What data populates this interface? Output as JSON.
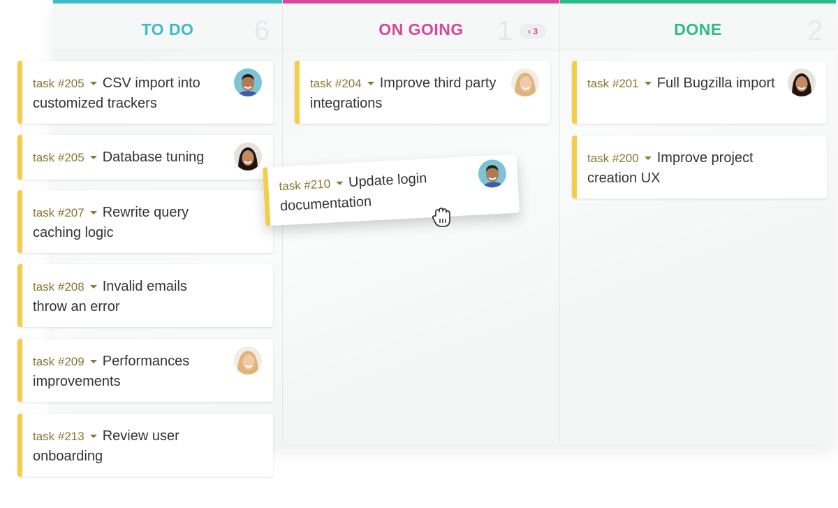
{
  "columns": [
    {
      "title": "TO DO",
      "count": "6",
      "color": "#3bbccb"
    },
    {
      "title": "ON GOING",
      "count": "1",
      "color": "#d9479a",
      "limit_badge": "‹ 3"
    },
    {
      "title": "DONE",
      "count": "2",
      "color": "#2ebb8c"
    }
  ],
  "todo": [
    {
      "id": "task #205",
      "title": "CSV import into customized trackers",
      "avatar": "man-avatar-icon"
    },
    {
      "id": "task #205",
      "title": "Database tuning",
      "avatar": "woman-dark-hair-avatar-icon"
    },
    {
      "id": "task #207",
      "title": "Rewrite query caching logic"
    },
    {
      "id": "task #208",
      "title": "Invalid emails throw an error"
    },
    {
      "id": "task #209",
      "title": "Performances improvements",
      "avatar": "woman-blonde-avatar-icon"
    },
    {
      "id": "task #213",
      "title": "Review user onboarding"
    }
  ],
  "ongoing": [
    {
      "id": "task #204",
      "title": "Improve third party integrations",
      "avatar": "woman-blonde-avatar-icon"
    }
  ],
  "done": [
    {
      "id": "task #201",
      "title": "Full Bugzilla import",
      "avatar": "woman-dark-hair-avatar-icon"
    },
    {
      "id": "task #200",
      "title": "Improve project creation UX"
    }
  ],
  "dragging": {
    "id": "task #210",
    "title": "Update login documentation",
    "avatar": "man-avatar-icon"
  },
  "colors": {
    "card_accent": "#f5cd48",
    "task_id": "#8a7531"
  }
}
